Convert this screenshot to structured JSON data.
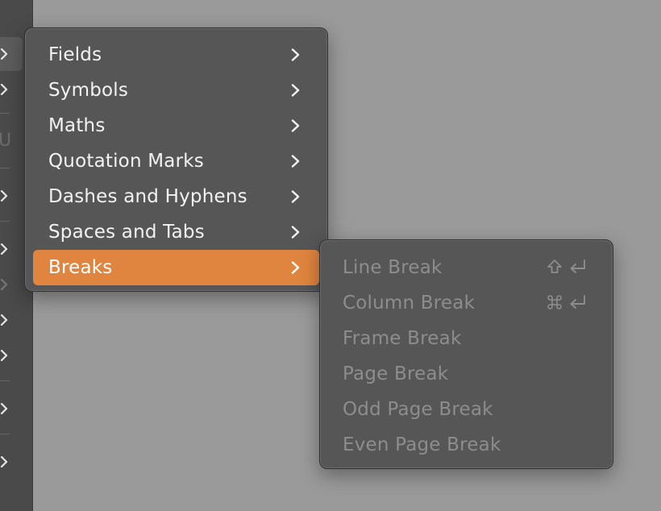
{
  "menu": {
    "items": [
      {
        "label": "Fields"
      },
      {
        "label": "Symbols"
      },
      {
        "label": "Maths"
      },
      {
        "label": "Quotation Marks"
      },
      {
        "label": "Dashes and Hyphens"
      },
      {
        "label": "Spaces and Tabs"
      },
      {
        "label": "Breaks"
      }
    ]
  },
  "submenu": {
    "items": [
      {
        "label": "Line Break",
        "shortcut": [
          "shift-icon",
          "return-icon"
        ]
      },
      {
        "label": "Column Break",
        "shortcut": [
          "command-icon",
          "return-icon"
        ]
      },
      {
        "label": "Frame Break"
      },
      {
        "label": "Page Break"
      },
      {
        "label": "Odd Page Break"
      },
      {
        "label": "Even Page Break"
      }
    ]
  },
  "colors": {
    "highlight": "#e0853f",
    "menu_bg": "#565656",
    "desktop_bg": "#9a9a9a",
    "disabled_text": "#8d8d8d"
  }
}
